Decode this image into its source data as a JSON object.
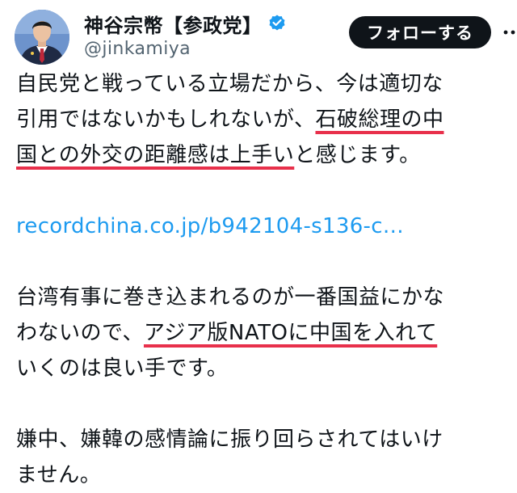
{
  "author": {
    "display_name": "神谷宗幣【参政党】",
    "handle": "@jinkamiya",
    "verified": true,
    "avatar_icon": "profile-photo-man-suit"
  },
  "actions": {
    "follow_label": "フォローする",
    "more_icon": "more-options-icon"
  },
  "tweet": {
    "para1": {
      "line1": "自民党と戦っている立場だから、今は適切な",
      "line2_pre": "引用ではないかもしれないが、",
      "line2_hl": "石破総理の中",
      "line3_hl": "国との外交の距離感は上手い",
      "line3_post": "と感じます。"
    },
    "link_text": "recordchina.co.jp/b942104-s136-c…",
    "para2": {
      "line1": "台湾有事に巻き込まれるのが一番国益にかな",
      "line2_pre": "わないので、",
      "line2_hl": "アジア版NATOに中国を入れて",
      "line3": "いくのは良い手です。"
    },
    "para3": {
      "line1": "嫌中、嫌韓の感情論に振り回らされてはいけ",
      "line2": "ません。"
    }
  },
  "colors": {
    "text": "#0f1419",
    "secondary": "#536471",
    "link": "#1d9bf0",
    "verified_badge": "#1d9bf0",
    "follow_button_bg": "#0f1419",
    "highlight_underline": "#e8304b"
  }
}
